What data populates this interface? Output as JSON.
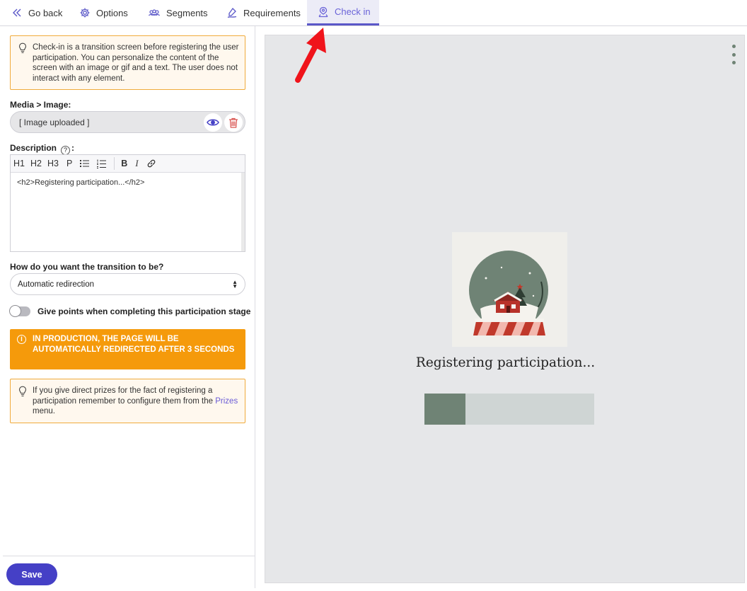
{
  "nav": {
    "go_back": "Go back",
    "options": "Options",
    "segments": "Segments",
    "requirements": "Requirements",
    "check_in": "Check in"
  },
  "left": {
    "intro_text": "Check-in is a transition screen before registering the user participation. You can personalize the content of the screen with an image or gif and a text. The user does not interact with any element.",
    "media_label": "Media > Image:",
    "media_value": "[ Image uploaded ]",
    "description_label": "Description",
    "description_colon": ":",
    "toolbar": {
      "h1": "H1",
      "h2": "H2",
      "h3": "H3",
      "p": "P",
      "bold": "B",
      "italic": "I"
    },
    "editor_content": "<h2>Registering participation...</h2>",
    "transition_label": "How do you want the transition to be?",
    "transition_value": "Automatic redirection",
    "points_toggle_label": "Give points when completing this participation stage",
    "points_toggle_on": false,
    "warning_text": "IN PRODUCTION, THE PAGE WILL BE AUTOMATICALLY REDIRECTED AFTER 3 SECONDS",
    "prizes_text_before": "If you give direct prizes for the fact of registering a participation remember to configure them from the",
    "prizes_link": "Prizes",
    "prizes_text_after": "menu.",
    "save_label": "Save"
  },
  "preview": {
    "title": "Registering participation...",
    "progress": 0.24
  },
  "colors": {
    "accent": "#4540c6",
    "active_tab": "#6a63d8",
    "warning": "#f59a0b",
    "info_border": "#f0ab3c",
    "preview_green": "#6f8375"
  }
}
